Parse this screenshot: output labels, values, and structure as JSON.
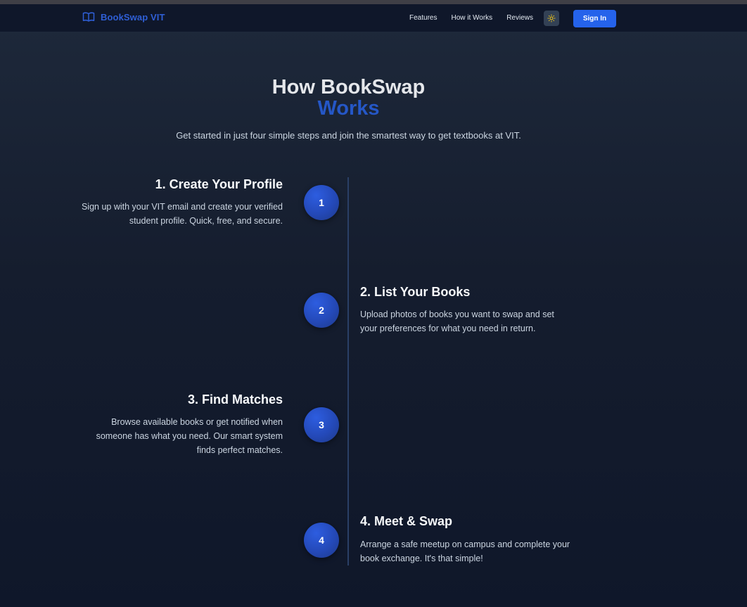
{
  "nav": {
    "brand": "BookSwap VIT",
    "links": [
      "Features",
      "How it Works",
      "Reviews"
    ],
    "sign_in": "Sign In"
  },
  "section": {
    "title_line1": "How BookSwap",
    "title_line2": "Works",
    "subtitle": "Get started in just four simple steps and join the smartest way to get textbooks at VIT."
  },
  "steps": [
    {
      "number": "1",
      "title": "1. Create Your Profile",
      "description": "Sign up with your VIT email and create your verified student profile. Quick, free, and secure."
    },
    {
      "number": "2",
      "title": "2. List Your Books",
      "description": "Upload photos of books you want to swap and set your preferences for what you need in return."
    },
    {
      "number": "3",
      "title": "3. Find Matches",
      "description": "Browse available books or get notified when someone has what you need. Our smart system finds perfect matches."
    },
    {
      "number": "4",
      "title": "4. Meet & Swap",
      "description": "Arrange a safe meetup on campus and complete your book exchange. It's that simple!"
    }
  ],
  "icons": {
    "brand": "book-open-icon",
    "theme_toggle": "sun-icon"
  },
  "colors": {
    "accent": "#2563eb",
    "brand": "#2f5fd6",
    "background": "#0f172a"
  }
}
